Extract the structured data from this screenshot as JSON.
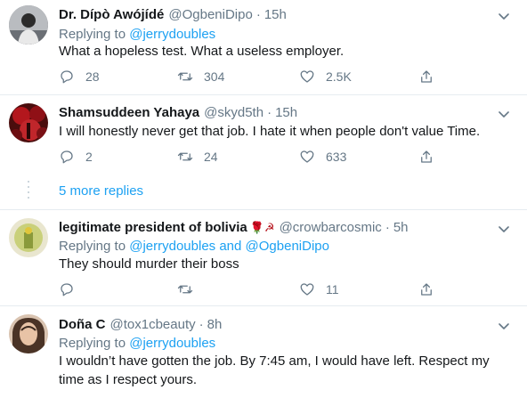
{
  "tweets": [
    {
      "name": "Dr. Dípò Awójídé",
      "handle": "@OgbeniDipo",
      "time": "15h",
      "replying_prefix": "Replying to",
      "replying_to": "@jerrydoubles",
      "text": "What a hopeless test. What a useless employer.",
      "replies": "28",
      "retweets": "304",
      "likes": "2.5K"
    },
    {
      "name": "Shamsuddeen Yahaya",
      "handle": "@skyd5th",
      "time": "15h",
      "text": "I will honestly never get that job. I hate it when people don't value Time.",
      "replies": "2",
      "retweets": "24",
      "likes": "633"
    },
    {
      "name": "legitimate president of bolivia",
      "name_emoji": "🌹☭",
      "handle": "@crowbarcosmic",
      "time": "5h",
      "replying_prefix": "Replying to",
      "replying_to_1": "@jerrydoubles",
      "replying_and": "and",
      "replying_to_2": "@OgbeniDipo",
      "text": "They should murder their boss",
      "replies": "",
      "retweets": "",
      "likes": "11"
    },
    {
      "name": "Doña C",
      "handle": "@tox1cbeauty",
      "time": "8h",
      "replying_prefix": "Replying to",
      "replying_to": "@jerrydoubles",
      "text_line1": "I wouldn’t have gotten the job. By 7:45 am, I would have left. Respect my",
      "text_line2": "time as I respect yours."
    }
  ],
  "thread": {
    "more_replies": "5 more replies"
  },
  "separator_dot": "·",
  "colors": {
    "accent": "#1da1f2",
    "secondary_text": "#657786",
    "divider": "#e6ecf0",
    "thread_line": "#ccd6dd"
  },
  "icons": [
    "chevron-down-icon",
    "reply-icon",
    "retweet-icon",
    "like-icon",
    "share-icon"
  ]
}
